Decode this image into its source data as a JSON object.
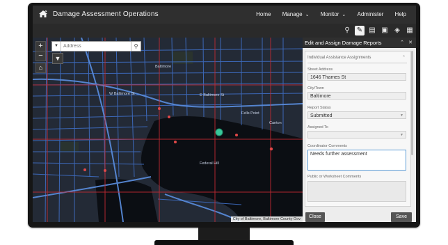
{
  "app": {
    "title": "Damage Assessment Operations",
    "logo_icon": "house-damage-icon"
  },
  "nav": {
    "items": [
      {
        "label": "Home",
        "has_dropdown": false
      },
      {
        "label": "Manage",
        "has_dropdown": true
      },
      {
        "label": "Monitor",
        "has_dropdown": true
      },
      {
        "label": "Administer",
        "has_dropdown": false
      },
      {
        "label": "Help",
        "has_dropdown": false
      }
    ]
  },
  "toolbar": {
    "tools": [
      "pin-icon",
      "edit-pencil-icon",
      "table-icon",
      "photo-icon",
      "layers-icon",
      "grid-icon"
    ],
    "active_tool": "edit-pencil-icon"
  },
  "map": {
    "search_placeholder": "Address",
    "zoom_in": "+",
    "zoom_out": "−",
    "attribution": "City of Baltimore, Baltimore County Gov",
    "labels": [
      "Baltimore",
      "W Baltimore St",
      "E Baltimore St",
      "Fells Point",
      "Federal Hill",
      "Canton"
    ],
    "colors": {
      "water": "#0b0e13",
      "roads": "#3f6fc7",
      "grid": "#c22a33",
      "land": "#232a36",
      "incident": "#e04848",
      "selected": "#39c79a"
    }
  },
  "panel": {
    "title": "Edit and Assign Damage Reports",
    "section_title": "Individual Assistance Assignments",
    "fields": {
      "street_address_label": "Street Address",
      "street_address_value": "1646 Thames St",
      "city_town_label": "City/Town",
      "city_town_value": "Baltimore",
      "report_status_label": "Report Status",
      "report_status_value": "Submitted",
      "assigned_to_label": "Assigned To",
      "assigned_to_value": "",
      "coordinator_comments_label": "Coordinator Comments",
      "coordinator_comments_value": "Needs further assessment",
      "public_comments_label": "Public or Worksheet Comments"
    },
    "close_label": "Close",
    "save_label": "Save"
  }
}
